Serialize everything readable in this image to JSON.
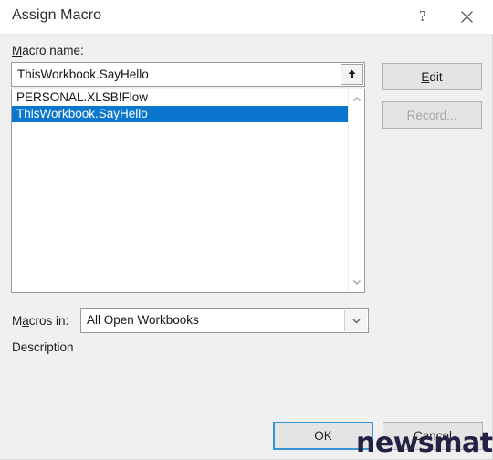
{
  "window": {
    "title": "Assign Macro",
    "help_icon": "question-mark-icon",
    "close_icon": "close-x-icon"
  },
  "form": {
    "macro_name_label": "Macro name:",
    "macro_name_accelerator": "M",
    "macro_name_value": "ThisWorkbook.SayHello",
    "macro_name_placeholder": "",
    "spin_icon": "up-arrow-icon",
    "macros_in_label": "Macros in:",
    "macros_in_accelerator": "a",
    "macros_in_value": "All Open Workbooks",
    "macros_in_options": [
      "All Open Workbooks"
    ],
    "dropdown_icon": "chevron-down-icon",
    "description_label": "Description"
  },
  "macro_list": {
    "items": [
      {
        "name": "PERSONAL.XLSB!Flow",
        "selected": false
      },
      {
        "name": "ThisWorkbook.SayHello",
        "selected": true
      }
    ],
    "scrollbar": {
      "up_icon": "chevron-up-icon",
      "down_icon": "chevron-down-icon"
    }
  },
  "side_buttons": {
    "edit_label": "Edit",
    "edit_accelerator": "E",
    "edit_enabled": true,
    "record_label": "Record...",
    "record_enabled": false
  },
  "footer_buttons": {
    "ok_label": "OK",
    "cancel_label": "Cancel",
    "ok_focused": true
  },
  "watermark": {
    "text": "newsmatic"
  },
  "colors": {
    "selection_blue": "#0a76cd",
    "dialog_background": "#f0f0f0",
    "focus_border": "#3a93d4",
    "watermark": "#232144"
  }
}
